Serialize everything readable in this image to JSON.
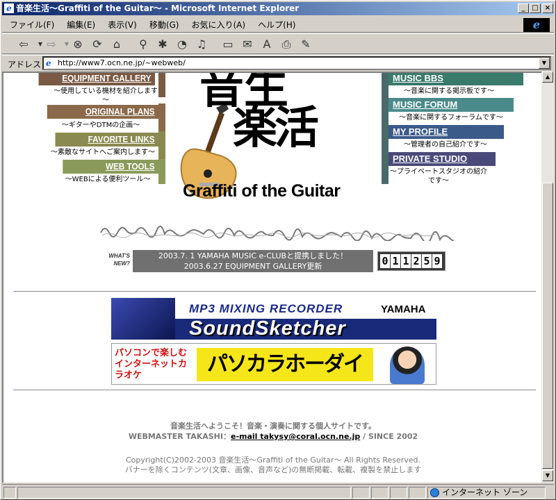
{
  "window": {
    "title": "音楽生活～Graffiti of the Guitar～ - Microsoft Internet Explorer",
    "min_glyph": "_",
    "max_glyph": "□",
    "close_glyph": "×"
  },
  "menubar": {
    "items": [
      "ファイル(F)",
      "編集(E)",
      "表示(V)",
      "移動(G)",
      "お気に入り(A)",
      "ヘルプ(H)"
    ]
  },
  "toolbar": {
    "icons": [
      "back-icon",
      "forward-icon",
      "stop-icon",
      "refresh-icon",
      "home-icon",
      "search-icon",
      "favorites-icon",
      "history-icon",
      "media-icon",
      "fullscreen-icon",
      "mail-icon",
      "font-icon",
      "print-icon",
      "edit-icon"
    ]
  },
  "address": {
    "label": "アドレス",
    "url": "http://www7.ocn.ne.jp/~webweb/"
  },
  "nav_left": [
    {
      "label": "EQUIPMENT GALLERY",
      "desc": "～使用している機材を紹介します～",
      "color": "#7a5a45"
    },
    {
      "label": "ORIGINAL PLANS",
      "desc": "～ギターやDTMの企画～",
      "color": "#8a6a4a"
    },
    {
      "label": "FAVORITE LINKS",
      "desc": "～素敵なサイトへご案内します～",
      "color": "#8a8a50"
    },
    {
      "label": "WEB TOOLS",
      "desc": "～WEBによる便利ツール～",
      "color": "#8a9a5a"
    }
  ],
  "nav_right": [
    {
      "label": "MUSIC BBS",
      "desc": "～音楽に関する掲示板です～",
      "color": "#3a7a6a"
    },
    {
      "label": "MUSIC FORUM",
      "desc": "～音楽に関するフォーラムです～",
      "color": "#4a8a8a"
    },
    {
      "label": "MY PROFILE",
      "desc": "～管理者の自己紹介です～",
      "color": "#3a5a8a"
    },
    {
      "label": "PRIVATE STUDIO",
      "desc": "～プライベートスタジオの紹介です～",
      "color": "#4a4a7a"
    }
  ],
  "logo": {
    "kanji_top": "音生",
    "kanji_bottom": "楽活",
    "english": "Graffiti of the Guitar"
  },
  "news": {
    "whats_new": "WHAT'S NEW?",
    "lines": [
      "2003.7. 1 YAMAHA MUSIC e-CLUBと提携しました！",
      "2003.6.27 EQUIPMENT GALLERY更新"
    ]
  },
  "counter": [
    "0",
    "1",
    "1",
    "2",
    "5",
    "9"
  ],
  "banners": {
    "yamaha": {
      "line1": "MP3 MIXING RECORDER",
      "brand": "YAMAHA",
      "product": "SoundSketcher"
    },
    "karaoke": {
      "left": "パソコンで楽しむインターネットカラオケ",
      "main": "パソカラホーダイ"
    }
  },
  "footer": {
    "welcome": "音楽生活へようこそ！音楽・演奏に関する個人サイトです。",
    "webmaster_prefix": "WEBMASTER TAKASHI：",
    "email": "e-mail takysy@coral.ocn.ne.jp",
    "since": " / SINCE 2002",
    "copyright": "Copyright(C)2002-2003 音楽生活～Graffiti of the Guitar～ All Rights Reserved.",
    "notice": "バナーを除くコンテンツ(文章、画像、音声など)の無断掲載、転載、複製を禁止します"
  },
  "status": {
    "zone": "インターネット ゾーン"
  }
}
